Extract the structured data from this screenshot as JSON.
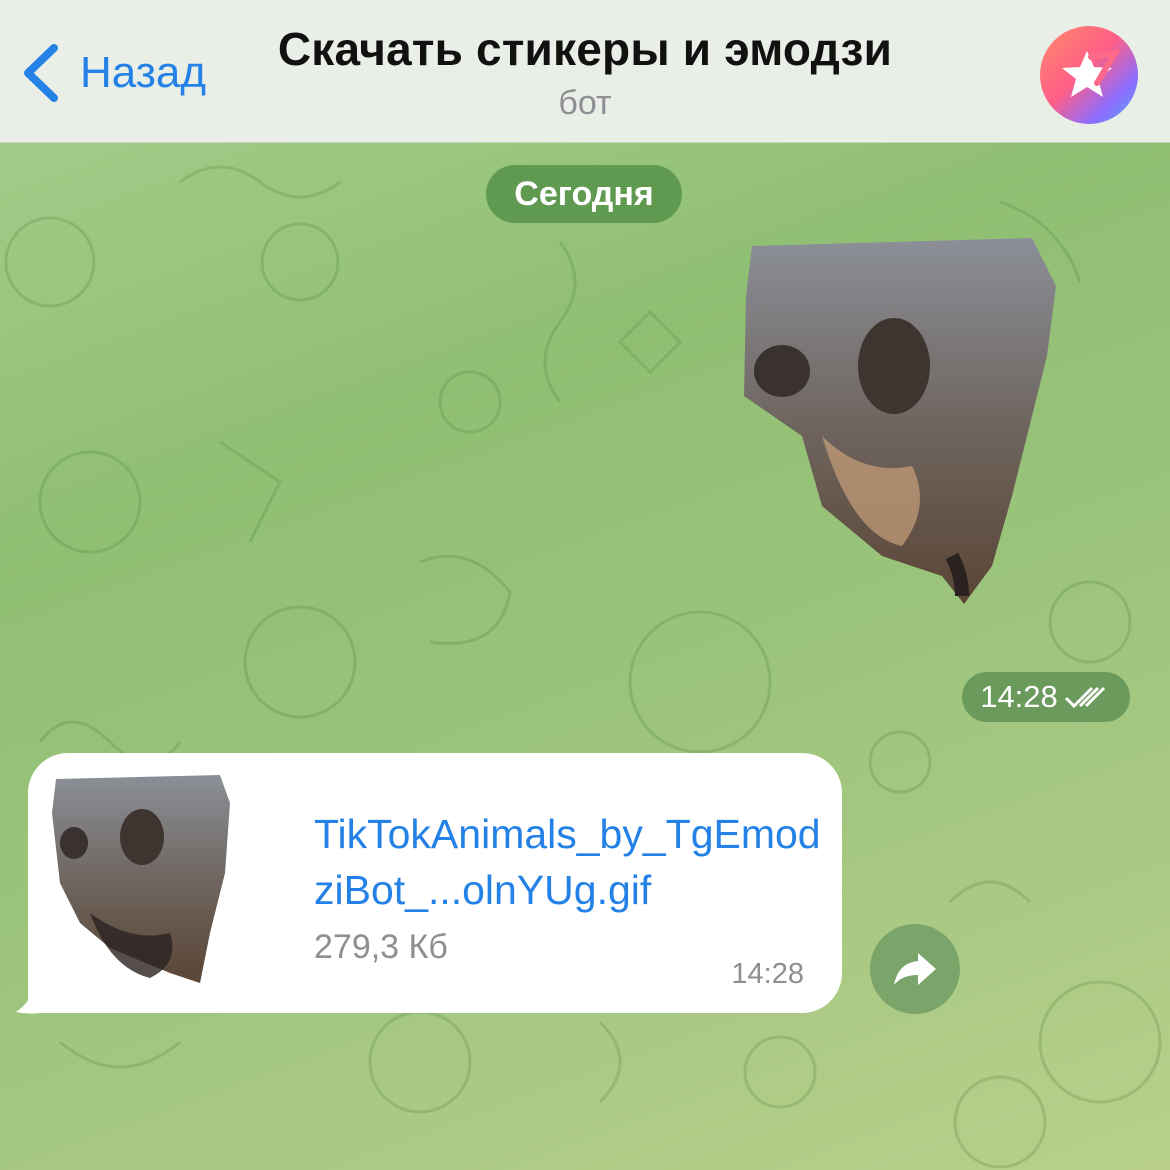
{
  "header": {
    "back_label": "Назад",
    "title": "Скачать стикеры и эмодзи",
    "subtitle": "бот",
    "avatar_icon": "bot-star-logo"
  },
  "chat": {
    "date_separator": "Сегодня",
    "outgoing_sticker": {
      "time": "14:28",
      "status_icon": "double-check-icon"
    },
    "incoming_file": {
      "file_name": "TikTokAnimals_by_TgEmodziBot_...olnYUg.gif",
      "file_size": "279,3 Кб",
      "time": "14:28"
    },
    "forward_icon": "share-arrow-icon"
  },
  "colors": {
    "accent": "#2481e6",
    "header_bg": "#e9eee6",
    "pill_bg": "#5f9a50"
  }
}
